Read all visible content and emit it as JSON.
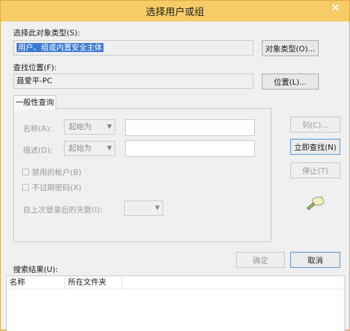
{
  "window": {
    "title": "选择用户或组",
    "close_glyph": "✕"
  },
  "object_type": {
    "label": "选择此对象类型(S):",
    "value": "用户、组或内置安全主体",
    "button": "对象类型(O)..."
  },
  "location": {
    "label": "查找位置(F):",
    "value": "聂爱平-PC",
    "button": "位置(L)..."
  },
  "query_tab": {
    "label": "一般性查询"
  },
  "query": {
    "name_label": "名称(A):",
    "name_mode": "起始为",
    "desc_label": "描述(D):",
    "desc_mode": "起始为",
    "disabled_accounts": "禁用的帐户(B)",
    "non_expiring_pwd": "不过期密码(X)",
    "days_since_logon": "自上次登录后的天数(I):"
  },
  "side_buttons": {
    "columns": "列(C)...",
    "find_now": "立即查找(N)",
    "stop": "停止(T)"
  },
  "footer": {
    "ok": "确定",
    "cancel": "取消"
  },
  "results": {
    "label": "搜索结果(U):",
    "columns": [
      "名称",
      "所在文件夹"
    ]
  },
  "icons": {
    "search_icon": "search-magnifier-icon",
    "dropdown_icon": "chevron-down-icon"
  },
  "colors": {
    "titlebar": "#f6cc66",
    "selection": "#3b78d4",
    "window_bg": "#f0f0f0"
  }
}
